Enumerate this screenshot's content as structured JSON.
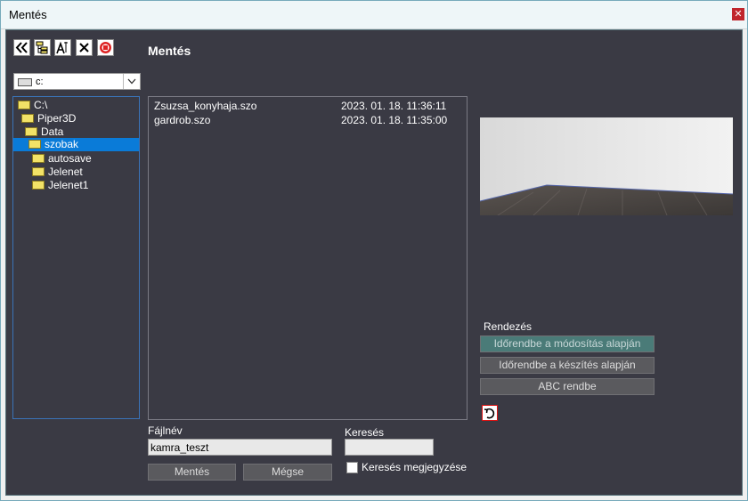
{
  "window": {
    "title": "Mentés"
  },
  "toolbar": {
    "icons": [
      "double-chevron-left-icon",
      "tree-expand-icon",
      "rename-icon",
      "delete-icon",
      "stop-icon"
    ]
  },
  "drive": {
    "value": "c:"
  },
  "tree": [
    {
      "label": "C:\\"
    },
    {
      "label": "Piper3D"
    },
    {
      "label": "Data"
    },
    {
      "label": "szobak"
    },
    {
      "label": "autosave"
    },
    {
      "label": "Jelenet"
    },
    {
      "label": "Jelenet1"
    }
  ],
  "section_title": "Mentés",
  "files": [
    {
      "name": "Zsuzsa_konyhaja.szo",
      "date": "2023. 01. 18. 11:36:11"
    },
    {
      "name": "gardrob.szo",
      "date": "2023. 01. 18. 11:35:00"
    }
  ],
  "filename": {
    "label": "Fájlnév",
    "value": "kamra_teszt"
  },
  "search": {
    "label": "Keresés",
    "value": "",
    "remember_label": "Keresés megjegyzése"
  },
  "buttons": {
    "save": "Mentés",
    "cancel": "Mégse"
  },
  "sort": {
    "label": "Rendezés",
    "by_modified": "Időrendbe a módosítás alapján",
    "by_created": "Időrendbe a készítés alapján",
    "alphabetical": "ABC rendbe"
  },
  "colors": {
    "background": "#3a3a44",
    "selection": "#0a7bd8",
    "active_button": "#4a7b78"
  }
}
